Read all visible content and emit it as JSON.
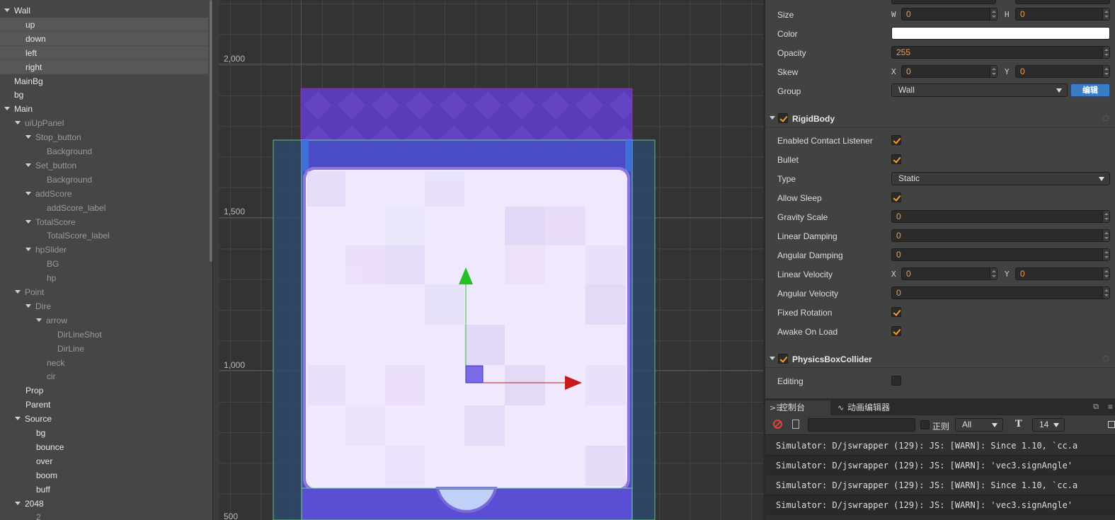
{
  "hierarchy": {
    "nodes": [
      {
        "label": "Wall",
        "indent": 0,
        "expanded": true,
        "selected": false,
        "tone": "white"
      },
      {
        "label": "up",
        "indent": 1,
        "expanded": null,
        "selected": true,
        "tone": "white"
      },
      {
        "label": "down",
        "indent": 1,
        "expanded": null,
        "selected": true,
        "tone": "white"
      },
      {
        "label": "left",
        "indent": 1,
        "expanded": null,
        "selected": true,
        "tone": "white"
      },
      {
        "label": "right",
        "indent": 1,
        "expanded": null,
        "selected": true,
        "tone": "white"
      },
      {
        "label": "MainBg",
        "indent": 0,
        "expanded": null,
        "selected": false,
        "tone": "white"
      },
      {
        "label": "bg",
        "indent": 0,
        "expanded": null,
        "selected": false,
        "tone": "white"
      },
      {
        "label": "Main",
        "indent": 0,
        "expanded": true,
        "selected": false,
        "tone": "white"
      },
      {
        "label": "uiUpPanel",
        "indent": 1,
        "expanded": true,
        "selected": false,
        "tone": "dim"
      },
      {
        "label": "Stop_button",
        "indent": 2,
        "expanded": true,
        "selected": false,
        "tone": "dim"
      },
      {
        "label": "Background",
        "indent": 3,
        "expanded": null,
        "selected": false,
        "tone": "dim"
      },
      {
        "label": "Set_button",
        "indent": 2,
        "expanded": true,
        "selected": false,
        "tone": "dim"
      },
      {
        "label": "Background",
        "indent": 3,
        "expanded": null,
        "selected": false,
        "tone": "dim"
      },
      {
        "label": "addScore",
        "indent": 2,
        "expanded": true,
        "selected": false,
        "tone": "dim"
      },
      {
        "label": "addScore_label",
        "indent": 3,
        "expanded": null,
        "selected": false,
        "tone": "dim"
      },
      {
        "label": "TotalScore",
        "indent": 2,
        "expanded": true,
        "selected": false,
        "tone": "dim"
      },
      {
        "label": "TotalScore_label",
        "indent": 3,
        "expanded": null,
        "selected": false,
        "tone": "dim"
      },
      {
        "label": "hpSlider",
        "indent": 2,
        "expanded": true,
        "selected": false,
        "tone": "dim"
      },
      {
        "label": "BG",
        "indent": 3,
        "expanded": null,
        "selected": false,
        "tone": "dim"
      },
      {
        "label": "hp",
        "indent": 3,
        "expanded": null,
        "selected": false,
        "tone": "dim"
      },
      {
        "label": "Point",
        "indent": 1,
        "expanded": true,
        "selected": false,
        "tone": "dim"
      },
      {
        "label": "Dire",
        "indent": 2,
        "expanded": true,
        "selected": false,
        "tone": "dim"
      },
      {
        "label": "arrow",
        "indent": 3,
        "expanded": true,
        "selected": false,
        "tone": "dim"
      },
      {
        "label": "DirLineShot",
        "indent": 4,
        "expanded": null,
        "selected": false,
        "tone": "dim"
      },
      {
        "label": "DirLine",
        "indent": 4,
        "expanded": null,
        "selected": false,
        "tone": "dim"
      },
      {
        "label": "neck",
        "indent": 3,
        "expanded": null,
        "selected": false,
        "tone": "dim"
      },
      {
        "label": "cir",
        "indent": 3,
        "expanded": null,
        "selected": false,
        "tone": "dim"
      },
      {
        "label": "Prop",
        "indent": 1,
        "expanded": null,
        "selected": false,
        "tone": "white"
      },
      {
        "label": "Parent",
        "indent": 1,
        "expanded": null,
        "selected": false,
        "tone": "white"
      },
      {
        "label": "Source",
        "indent": 1,
        "expanded": true,
        "selected": false,
        "tone": "white"
      },
      {
        "label": "bg",
        "indent": 2,
        "expanded": null,
        "selected": false,
        "tone": "white"
      },
      {
        "label": "bounce",
        "indent": 2,
        "expanded": null,
        "selected": false,
        "tone": "white"
      },
      {
        "label": "over",
        "indent": 2,
        "expanded": null,
        "selected": false,
        "tone": "white"
      },
      {
        "label": "boom",
        "indent": 2,
        "expanded": null,
        "selected": false,
        "tone": "white"
      },
      {
        "label": "buff",
        "indent": 2,
        "expanded": null,
        "selected": false,
        "tone": "white"
      },
      {
        "label": "2048",
        "indent": 1,
        "expanded": true,
        "selected": false,
        "tone": "white"
      },
      {
        "label": "2",
        "indent": 2,
        "expanded": null,
        "selected": false,
        "tone": "dim"
      }
    ]
  },
  "scene": {
    "ruler_labels": [
      "2,000",
      "1,500",
      "1,000",
      "500"
    ]
  },
  "inspector": {
    "size": {
      "label": "Size",
      "w_axis": "W",
      "w_value": "0",
      "h_axis": "H",
      "h_value": "0"
    },
    "color": {
      "label": "Color",
      "value": "#ffffff"
    },
    "opacity": {
      "label": "Opacity",
      "value": "255"
    },
    "skew": {
      "label": "Skew",
      "x_axis": "X",
      "x_value": "0",
      "y_axis": "Y",
      "y_value": "0"
    },
    "group": {
      "label": "Group",
      "value": "Wall",
      "edit_button": "编辑"
    },
    "rigidbody": {
      "title": "RigidBody",
      "enabled": true,
      "enabled_contact_listener": {
        "label": "Enabled Contact Listener",
        "checked": true
      },
      "bullet": {
        "label": "Bullet",
        "checked": true
      },
      "type": {
        "label": "Type",
        "value": "Static"
      },
      "allow_sleep": {
        "label": "Allow Sleep",
        "checked": true
      },
      "gravity_scale": {
        "label": "Gravity Scale",
        "value": "0"
      },
      "linear_damping": {
        "label": "Linear Damping",
        "value": "0"
      },
      "angular_damping": {
        "label": "Angular Damping",
        "value": "0"
      },
      "linear_velocity": {
        "label": "Linear Velocity",
        "x_axis": "X",
        "x_value": "0",
        "y_axis": "Y",
        "y_value": "0"
      },
      "angular_velocity": {
        "label": "Angular Velocity",
        "value": "0"
      },
      "fixed_rotation": {
        "label": "Fixed Rotation",
        "checked": true
      },
      "awake_on_load": {
        "label": "Awake On Load",
        "checked": true
      }
    },
    "collider": {
      "title": "PhysicsBoxCollider",
      "enabled": true,
      "editing": {
        "label": "Editing",
        "checked": false
      }
    }
  },
  "console": {
    "tabs": [
      {
        "label": "控制台",
        "icon": "console-icon"
      },
      {
        "label": "动画编辑器",
        "icon": "animation-icon"
      }
    ],
    "toolbar": {
      "search_value": "",
      "regex_label": "正则",
      "level_value": "All",
      "font_size_value": "14"
    },
    "lines": [
      "Simulator: D/jswrapper (129): JS: [WARN]: Since 1.10, `cc.a",
      "Simulator: D/jswrapper (129): JS: [WARN]: 'vec3.signAngle'",
      "Simulator: D/jswrapper (129): JS: [WARN]: Since 1.10, `cc.a",
      "Simulator: D/jswrapper (129): JS: [WARN]: 'vec3.signAngle'"
    ]
  },
  "colors": {
    "accent_orange": "#f0a050",
    "check_orange": "#ff9a1e",
    "edit_button_blue": "#3a7dc4"
  }
}
